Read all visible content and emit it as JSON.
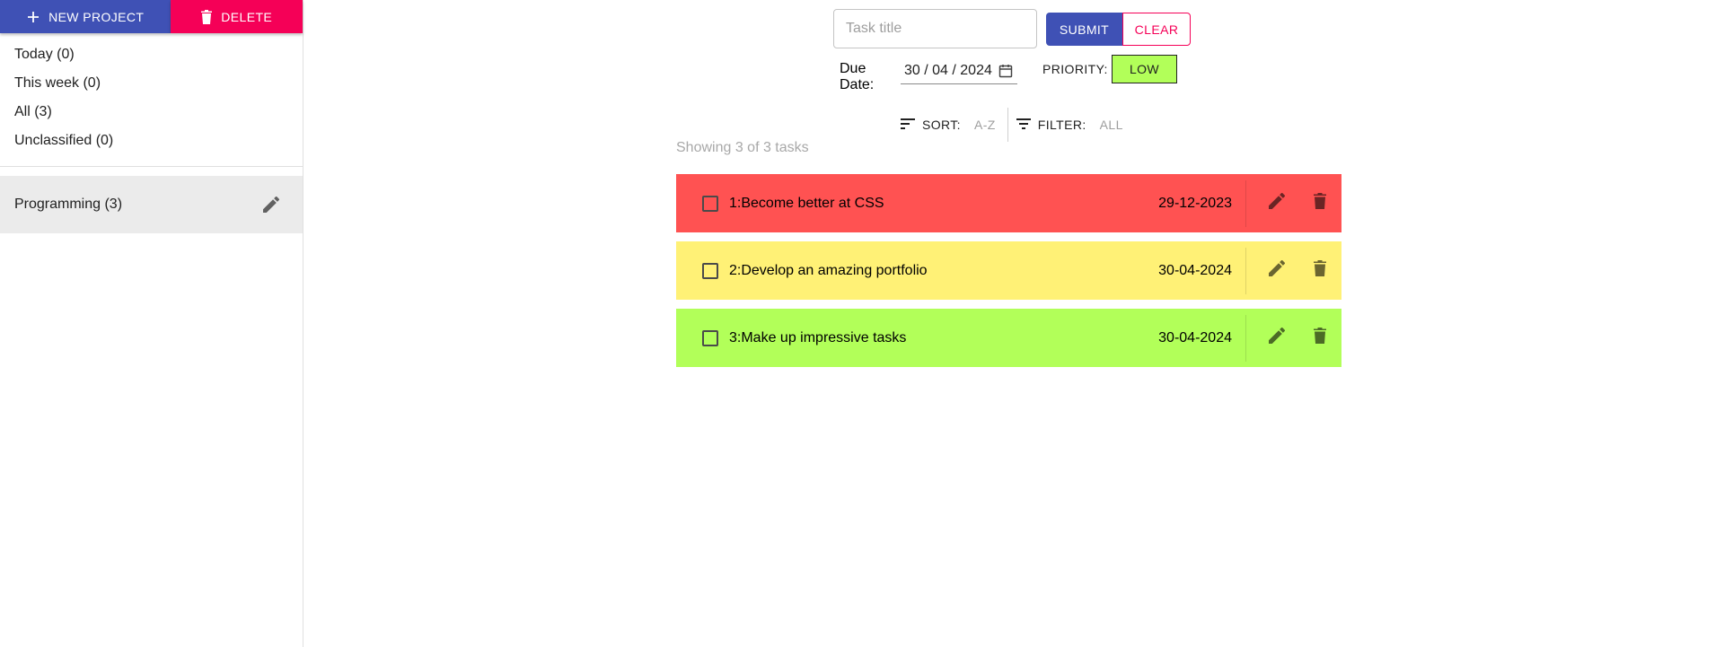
{
  "sidebar": {
    "new_project_label": "NEW PROJECT",
    "delete_label": "DELETE",
    "views": [
      {
        "label": "Today (0)"
      },
      {
        "label": "This week (0)"
      },
      {
        "label": "All (3)"
      },
      {
        "label": "Unclassified (0)"
      }
    ],
    "projects": [
      {
        "label": "Programming (3)",
        "selected": true
      }
    ]
  },
  "form": {
    "title_placeholder": "Task title",
    "title_value": "",
    "submit_label": "SUBMIT",
    "clear_label": "CLEAR",
    "due_label": "Due Date:",
    "due_value": "30 / 04 / 2024",
    "priority_label": "PRIORITY:",
    "priority_value": "LOW"
  },
  "toolbar": {
    "sort_label": "SORT:",
    "sort_value": "A-Z",
    "filter_label": "FILTER:",
    "filter_value": "ALL"
  },
  "status": {
    "showing": "Showing 3 of 3 tasks"
  },
  "tasks": [
    {
      "title": "1:Become better at CSS",
      "date": "29-12-2023",
      "priority": "high",
      "color": "#ff5252"
    },
    {
      "title": "2:Develop an amazing portfolio",
      "date": "30-04-2024",
      "priority": "medium",
      "color": "#fff176"
    },
    {
      "title": "3:Make up impressive tasks",
      "date": "30-04-2024",
      "priority": "low",
      "color": "#b2ff59"
    }
  ],
  "colors": {
    "primary": "#3f51b5",
    "secondary": "#f50057",
    "priority_low": "#b2ff59",
    "priority_medium": "#fff176",
    "priority_high": "#ff5252"
  },
  "icons": {
    "new_project": "plus-icon",
    "delete": "trash-icon",
    "project_edit": "pencil-icon",
    "calendar": "calendar-icon",
    "sort": "sort-icon",
    "filter": "filter-icon",
    "task_edit": "pencil-icon",
    "task_delete": "trash-icon"
  }
}
